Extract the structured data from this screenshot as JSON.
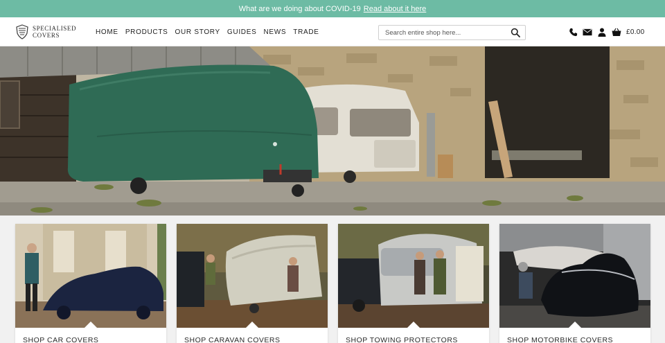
{
  "announcement": {
    "text": "What are we doing about COVID-19",
    "link_text": "Read about it here"
  },
  "brand": {
    "line1": "SPECIALISED",
    "line2": "COVERS",
    "logo_icon": "shield-crest-icon"
  },
  "nav": {
    "items": [
      {
        "label": "HOME"
      },
      {
        "label": "PRODUCTS"
      },
      {
        "label": "OUR STORY"
      },
      {
        "label": "GUIDES"
      },
      {
        "label": "NEWS"
      },
      {
        "label": "TRADE"
      }
    ]
  },
  "search": {
    "placeholder": "Search entire shop here...",
    "value": "",
    "icon": "search-icon"
  },
  "utility": {
    "icons": [
      "phone-icon",
      "mail-icon",
      "account-icon",
      "cart-icon"
    ],
    "cart_total": "£0.00"
  },
  "hero": {
    "image": "green-caravan-cover-farmyard",
    "description_colors": {
      "cover": "#2f6b55",
      "stone": "#b9a98a",
      "sky": "#d7d3c7"
    }
  },
  "categories": [
    {
      "label": "SHOP CAR COVERS"
    },
    {
      "label": "SHOP CARAVAN COVERS"
    },
    {
      "label": "SHOP TOWING PROTECTORS"
    },
    {
      "label": "SHOP MOTORBIKE COVERS"
    }
  ],
  "colors": {
    "announcement_bg": "#6dbba4",
    "text": "#1e1e1e"
  }
}
